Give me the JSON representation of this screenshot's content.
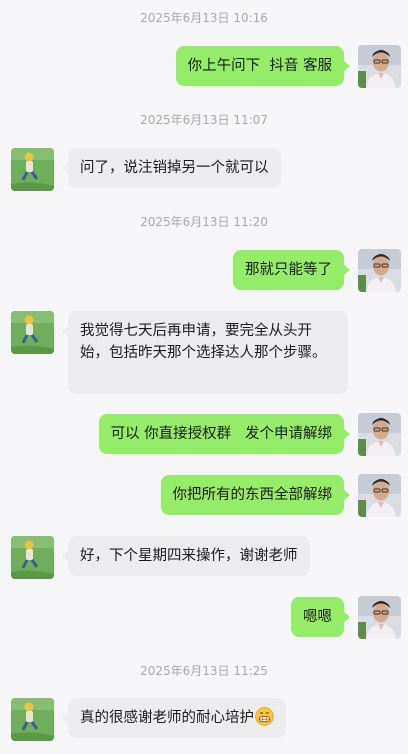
{
  "messages": [
    {
      "type": "time",
      "text": "2025年6月13日 10:16"
    },
    {
      "type": "out",
      "text": "你上午问下  抖音 客服"
    },
    {
      "type": "time",
      "text": "2025年6月13日 11:07"
    },
    {
      "type": "in",
      "text": "问了，说注销掉另一个就可以"
    },
    {
      "type": "time",
      "text": "2025年6月13日 11:20"
    },
    {
      "type": "out",
      "text": "那就只能等了"
    },
    {
      "type": "in",
      "text": "我觉得七天后再申请，要完全从头开始，包括昨天那个选择达人那个步骤。"
    },
    {
      "type": "out",
      "text": "可以 你直接授权群   发个申请解绑"
    },
    {
      "type": "out",
      "text": "你把所有的东西全部解绑"
    },
    {
      "type": "in",
      "text": "好，下个星期四来操作，谢谢老师"
    },
    {
      "type": "out",
      "text": "嗯嗯"
    },
    {
      "type": "time",
      "text": "2025年6月13日 11:25"
    },
    {
      "type": "in",
      "text": "真的很感谢老师的耐心培护",
      "emoji": "grinning-face-emoji"
    }
  ]
}
